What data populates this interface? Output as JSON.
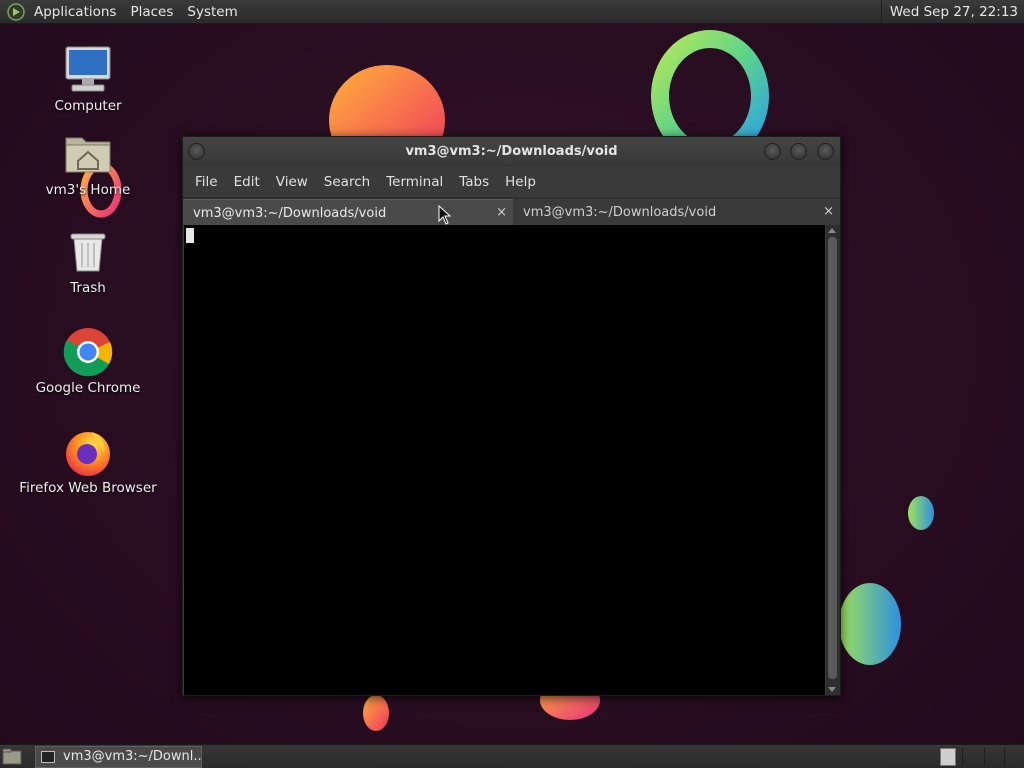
{
  "top_panel": {
    "menus": [
      "Applications",
      "Places",
      "System"
    ],
    "clock": "Wed Sep 27, 22:13"
  },
  "desktop": {
    "icons": [
      {
        "label": "Computer",
        "icon": "computer-icon"
      },
      {
        "label": "vm3's Home",
        "icon": "home-folder-icon"
      },
      {
        "label": "Trash",
        "icon": "trash-icon"
      },
      {
        "label": "Google Chrome",
        "icon": "chrome-icon"
      },
      {
        "label": "Firefox Web Browser",
        "icon": "firefox-icon"
      }
    ]
  },
  "terminal": {
    "title": "vm3@vm3:~/Downloads/void",
    "menu": [
      "File",
      "Edit",
      "View",
      "Search",
      "Terminal",
      "Tabs",
      "Help"
    ],
    "tabs": [
      {
        "label": "vm3@vm3:~/Downloads/void",
        "active": true,
        "close": "×"
      },
      {
        "label": "vm3@vm3:~/Downloads/void",
        "active": false,
        "close": "×"
      }
    ]
  },
  "bottom_panel": {
    "task_label": "vm3@vm3:~/Downl..."
  },
  "colors": {
    "wallpaper": "#2a0f22",
    "panel": "#2f2f2f",
    "terminal_bg": "#000000"
  }
}
